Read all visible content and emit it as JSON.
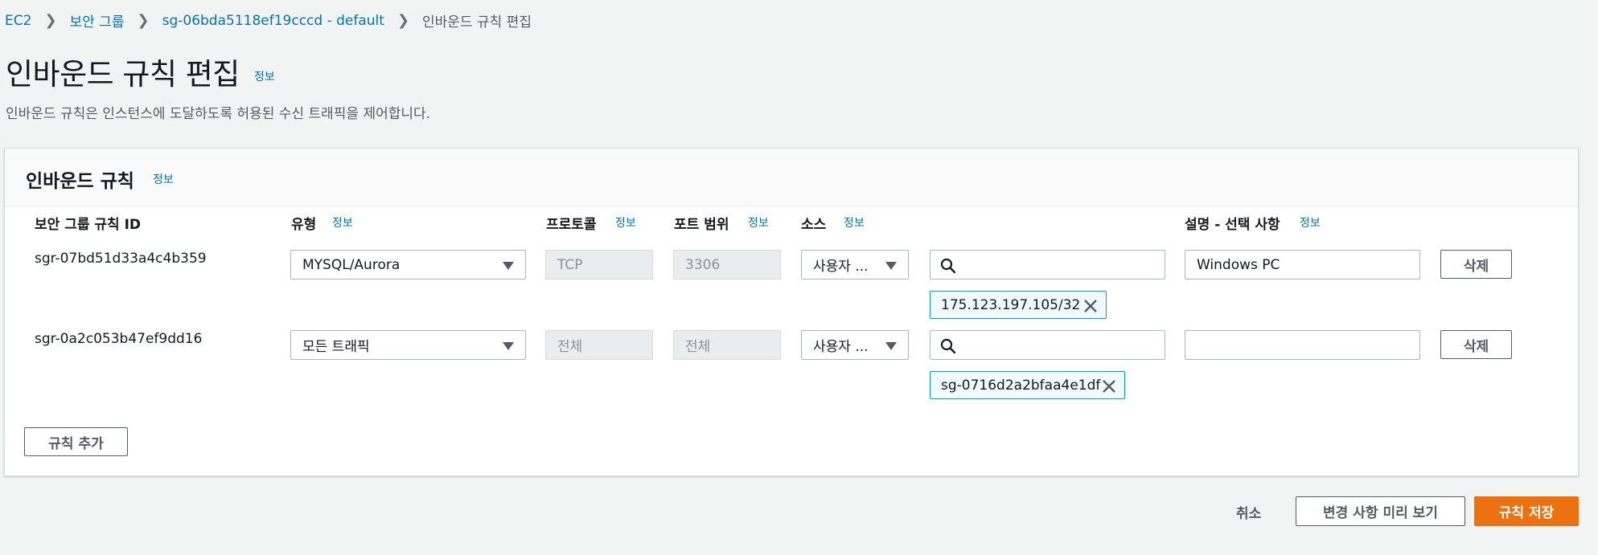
{
  "breadcrumb": {
    "items": [
      "EC2",
      "보안 그룹",
      "sg-06bda5118ef19cccd - default"
    ],
    "current": "인바운드 규칙 편집"
  },
  "page": {
    "title": "인바운드 규칙 편집",
    "info": "정보",
    "description": "인바운드 규칙은 인스턴스에 도달하도록 허용된 수신 트래픽을 제어합니다."
  },
  "panel": {
    "title": "인바운드 규칙",
    "info": "정보",
    "columns": {
      "rule_id": "보안 그룹 규칙 ID",
      "type": "유형",
      "protocol": "프로토콜",
      "port_range": "포트 범위",
      "source": "소스",
      "description": "설명 - 선택 사항",
      "info": "정보"
    },
    "rules": [
      {
        "id": "sgr-07bd51d33a4c4b359",
        "type": "MYSQL/Aurora",
        "protocol": "TCP",
        "port": "3306",
        "source": "사용자 ...",
        "search_value": "",
        "token": "175.123.197.105/32",
        "description": "Windows PC",
        "delete_label": "삭제"
      },
      {
        "id": "sgr-0a2c053b47ef9dd16",
        "type": "모든 트래픽",
        "protocol": "전체",
        "port": "전체",
        "source": "사용자 ...",
        "search_value": "",
        "token": "sg-0716d2a2bfaa4e1df",
        "description": "",
        "delete_label": "삭제"
      }
    ],
    "add_rule_label": "규칙 추가"
  },
  "footer": {
    "cancel_label": "취소",
    "preview_label": "변경 사항 미리 보기",
    "save_label": "규칙 저장"
  },
  "colors": {
    "link": "#0073bb",
    "primary": "#ec7211",
    "token_border": "#00a1c9",
    "background": "#f2f3f3"
  }
}
